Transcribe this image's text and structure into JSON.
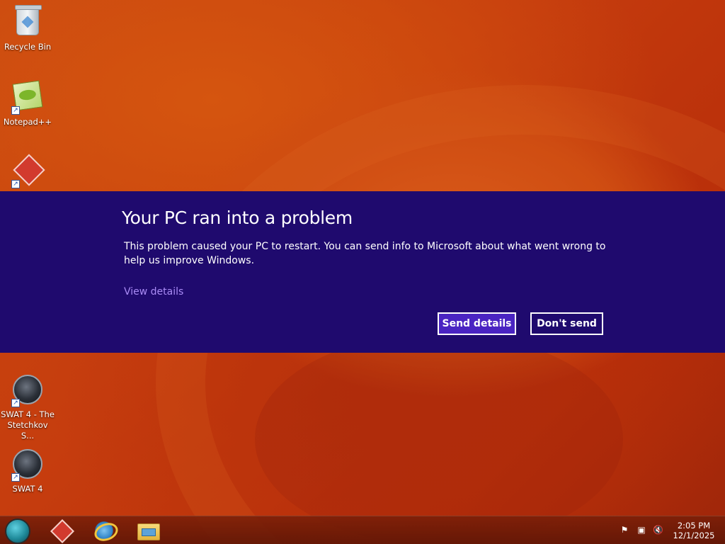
{
  "desktop": {
    "icons": [
      {
        "label": "Recycle Bin",
        "icon": "recycle-bin-icon"
      },
      {
        "label": "Notepad++",
        "icon": "notepad-plus-plus-icon"
      },
      {
        "label": "",
        "icon": "red-app-icon"
      },
      {
        "label": "SWAT 4 - The Stetchkov S...",
        "icon": "swat4-expansion-icon"
      },
      {
        "label": "SWAT 4",
        "icon": "swat4-icon"
      }
    ]
  },
  "dialog": {
    "title": "Your PC ran into a problem",
    "body": "This problem caused your PC to restart. You can send info to Microsoft about what went wrong to help us improve Windows.",
    "view_details_link": "View details",
    "send_button": "Send details",
    "dont_send_button": "Don't send",
    "colors": {
      "background": "#1f0a6e",
      "accent_button": "#4a24c2",
      "link": "#a98bf5"
    }
  },
  "taskbar": {
    "start": "start-orb-icon",
    "pinned": [
      "red-app-icon",
      "internet-explorer-icon",
      "file-explorer-icon"
    ],
    "tray": [
      "action-center-flag-icon",
      "network-icon",
      "volume-muted-icon"
    ],
    "clock": {
      "time": "2:05 PM",
      "date": "12/1/2025"
    }
  }
}
